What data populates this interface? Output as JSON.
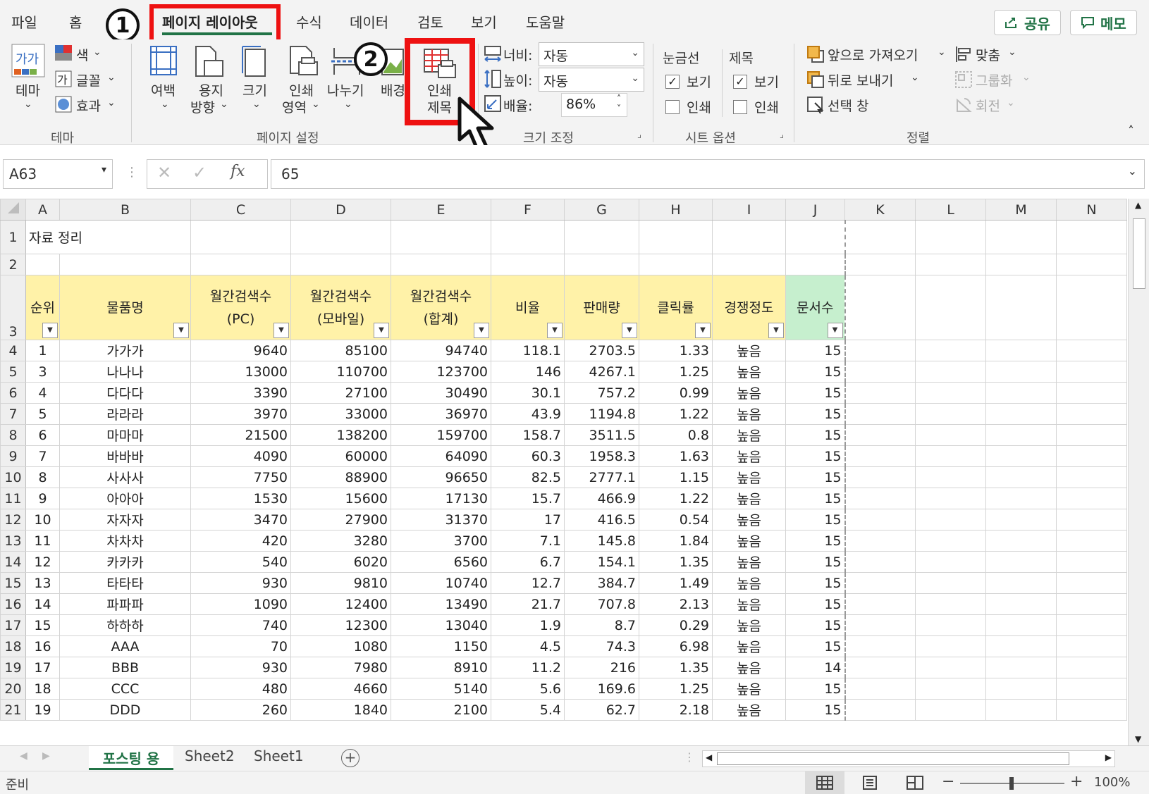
{
  "tabs": [
    "파일",
    "홈",
    "페이지 레이아웃",
    "수식",
    "데이터",
    "검토",
    "보기",
    "도움말"
  ],
  "badges": [
    "1",
    "2"
  ],
  "share_label": "공유",
  "memo_label": "메모",
  "ribbon": {
    "theme": {
      "big": "테마",
      "colors": "색",
      "fonts": "글꼴",
      "effects": "효과",
      "label": "테마"
    },
    "page_setup": {
      "margins": "여백",
      "orientation": [
        "용지",
        "방향"
      ],
      "size": "크기",
      "print_area": [
        "인쇄",
        "영역"
      ],
      "breaks": "나누기",
      "background": "배경",
      "print_titles": [
        "인쇄",
        "제목"
      ],
      "label": "페이지 설정"
    },
    "scale": {
      "width_label": "너비:",
      "width_value": "자동",
      "height_label": "높이:",
      "height_value": "자동",
      "scale_label": "배율:",
      "scale_value": "86%",
      "label": "크기 조정"
    },
    "sheet_options": {
      "gridlines": "눈금선",
      "headings": "제목",
      "view": "보기",
      "print": "인쇄",
      "label": "시트 옵션"
    },
    "arrange": {
      "bring_forward": "앞으로 가져오기",
      "send_backward": "뒤로 보내기",
      "selection_pane": "선택 창",
      "align": "맞춤",
      "group": "그룹화",
      "rotate": "회전",
      "label": "정렬"
    }
  },
  "formula_bar": {
    "name_box": "A63",
    "value": "65"
  },
  "columns": [
    "A",
    "B",
    "C",
    "D",
    "E",
    "F",
    "G",
    "H",
    "I",
    "J",
    "K",
    "L",
    "M",
    "N"
  ],
  "sheet_title": "자료 정리",
  "table_headers": [
    [
      "순위"
    ],
    [
      "물품명"
    ],
    [
      "월간검색수",
      "(PC)"
    ],
    [
      "월간검색수",
      "(모바일)"
    ],
    [
      "월간검색수",
      "(합계)"
    ],
    [
      "비율"
    ],
    [
      "판매량"
    ],
    [
      "클릭률"
    ],
    [
      "경쟁정도"
    ],
    [
      "문서수"
    ]
  ],
  "rows": [
    {
      "r": "4",
      "cells": [
        "1",
        "가가가",
        "9640",
        "85100",
        "94740",
        "118.1",
        "2703.5",
        "1.33",
        "높음",
        "15"
      ]
    },
    {
      "r": "5",
      "cells": [
        "3",
        "나나나",
        "13000",
        "110700",
        "123700",
        "146",
        "4267.1",
        "1.25",
        "높음",
        "15"
      ]
    },
    {
      "r": "6",
      "cells": [
        "4",
        "다다다",
        "3390",
        "27100",
        "30490",
        "30.1",
        "757.2",
        "0.99",
        "높음",
        "15"
      ]
    },
    {
      "r": "7",
      "cells": [
        "5",
        "라라라",
        "3970",
        "33000",
        "36970",
        "43.9",
        "1194.8",
        "1.22",
        "높음",
        "15"
      ]
    },
    {
      "r": "8",
      "cells": [
        "6",
        "마마마",
        "21500",
        "138200",
        "159700",
        "158.7",
        "3511.5",
        "0.8",
        "높음",
        "15"
      ]
    },
    {
      "r": "9",
      "cells": [
        "7",
        "바바바",
        "4090",
        "60000",
        "64090",
        "60.3",
        "1958.3",
        "1.63",
        "높음",
        "15"
      ]
    },
    {
      "r": "10",
      "cells": [
        "8",
        "사사사",
        "7750",
        "88900",
        "96650",
        "82.5",
        "2777.1",
        "1.15",
        "높음",
        "15"
      ]
    },
    {
      "r": "11",
      "cells": [
        "9",
        "아아아",
        "1530",
        "15600",
        "17130",
        "15.7",
        "466.9",
        "1.22",
        "높음",
        "15"
      ]
    },
    {
      "r": "12",
      "cells": [
        "10",
        "자자자",
        "3470",
        "27900",
        "31370",
        "17",
        "416.5",
        "0.54",
        "높음",
        "15"
      ]
    },
    {
      "r": "13",
      "cells": [
        "11",
        "차차차",
        "420",
        "3280",
        "3700",
        "7.1",
        "145.8",
        "1.84",
        "높음",
        "15"
      ]
    },
    {
      "r": "14",
      "cells": [
        "12",
        "카카카",
        "540",
        "6020",
        "6560",
        "6.7",
        "154.1",
        "1.35",
        "높음",
        "15"
      ]
    },
    {
      "r": "15",
      "cells": [
        "13",
        "타타타",
        "930",
        "9810",
        "10740",
        "12.7",
        "384.7",
        "1.49",
        "높음",
        "15"
      ]
    },
    {
      "r": "16",
      "cells": [
        "14",
        "파파파",
        "1090",
        "12400",
        "13490",
        "21.7",
        "707.8",
        "2.13",
        "높음",
        "15"
      ]
    },
    {
      "r": "17",
      "cells": [
        "15",
        "하하하",
        "740",
        "12300",
        "13040",
        "1.9",
        "8.7",
        "0.29",
        "높음",
        "15"
      ]
    },
    {
      "r": "18",
      "cells": [
        "16",
        "AAA",
        "70",
        "1080",
        "1150",
        "4.5",
        "74.3",
        "6.98",
        "높음",
        "15"
      ]
    },
    {
      "r": "19",
      "cells": [
        "17",
        "BBB",
        "930",
        "7980",
        "8910",
        "11.2",
        "216",
        "1.35",
        "높음",
        "14"
      ]
    },
    {
      "r": "20",
      "cells": [
        "18",
        "CCC",
        "480",
        "4660",
        "5140",
        "5.6",
        "169.6",
        "1.25",
        "높음",
        "15"
      ]
    },
    {
      "r": "21",
      "cells": [
        "19",
        "DDD",
        "260",
        "1840",
        "2100",
        "5.4",
        "62.7",
        "2.18",
        "높음",
        "15"
      ]
    }
  ],
  "sheet_tabs": [
    "포스팅 용",
    "Sheet2",
    "Sheet1"
  ],
  "status": {
    "mode": "준비",
    "zoom": "100%"
  }
}
